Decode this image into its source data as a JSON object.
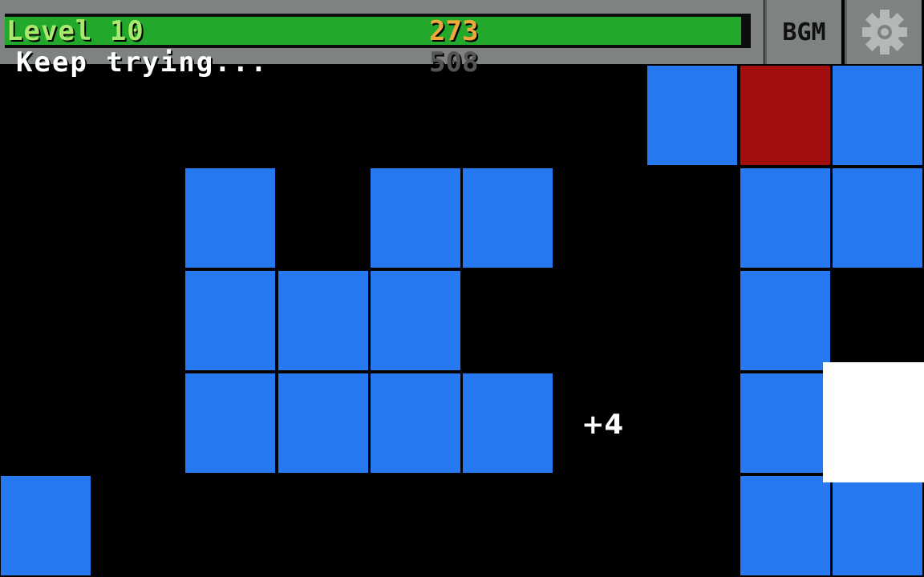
{
  "hud": {
    "level_label": "Level 10",
    "current_score": "273",
    "status_text": "Keep trying...",
    "target_score": "508",
    "progress_fraction": 0.987
  },
  "buttons": {
    "bgm_label": "BGM",
    "settings_icon": "gear-icon"
  },
  "popup": {
    "bonus_text": "+4"
  },
  "colors": {
    "hud_bar": "#7e8282",
    "progress_fill": "#22a82a",
    "level_text": "#a8e86c",
    "current_score_text": "#f0a83c",
    "status_text": "#ffffff",
    "target_score_text": "#555555",
    "tile_blue": "#2679f0",
    "tile_red": "#a20d0d",
    "player_block": "#ffffff",
    "background": "#000000"
  },
  "board": {
    "cols": 10,
    "rows": 6,
    "tiles": [
      {
        "col": 7,
        "row": 0,
        "kind": "blue"
      },
      {
        "col": 8,
        "row": 0,
        "kind": "red"
      },
      {
        "col": 9,
        "row": 0,
        "kind": "blue"
      },
      {
        "col": 2,
        "row": 1,
        "kind": "blue"
      },
      {
        "col": 4,
        "row": 1,
        "kind": "blue"
      },
      {
        "col": 5,
        "row": 1,
        "kind": "blue"
      },
      {
        "col": 8,
        "row": 1,
        "kind": "blue"
      },
      {
        "col": 9,
        "row": 1,
        "kind": "blue"
      },
      {
        "col": 2,
        "row": 2,
        "kind": "blue"
      },
      {
        "col": 3,
        "row": 2,
        "kind": "blue"
      },
      {
        "col": 4,
        "row": 2,
        "kind": "blue"
      },
      {
        "col": 8,
        "row": 2,
        "kind": "blue"
      },
      {
        "col": 2,
        "row": 3,
        "kind": "blue"
      },
      {
        "col": 3,
        "row": 3,
        "kind": "blue"
      },
      {
        "col": 4,
        "row": 3,
        "kind": "blue"
      },
      {
        "col": 5,
        "row": 3,
        "kind": "blue"
      },
      {
        "col": 8,
        "row": 3,
        "kind": "blue"
      },
      {
        "col": 0,
        "row": 4,
        "kind": "blue"
      },
      {
        "col": 8,
        "row": 4,
        "kind": "blue"
      },
      {
        "col": 9,
        "row": 4,
        "kind": "blue"
      }
    ]
  }
}
